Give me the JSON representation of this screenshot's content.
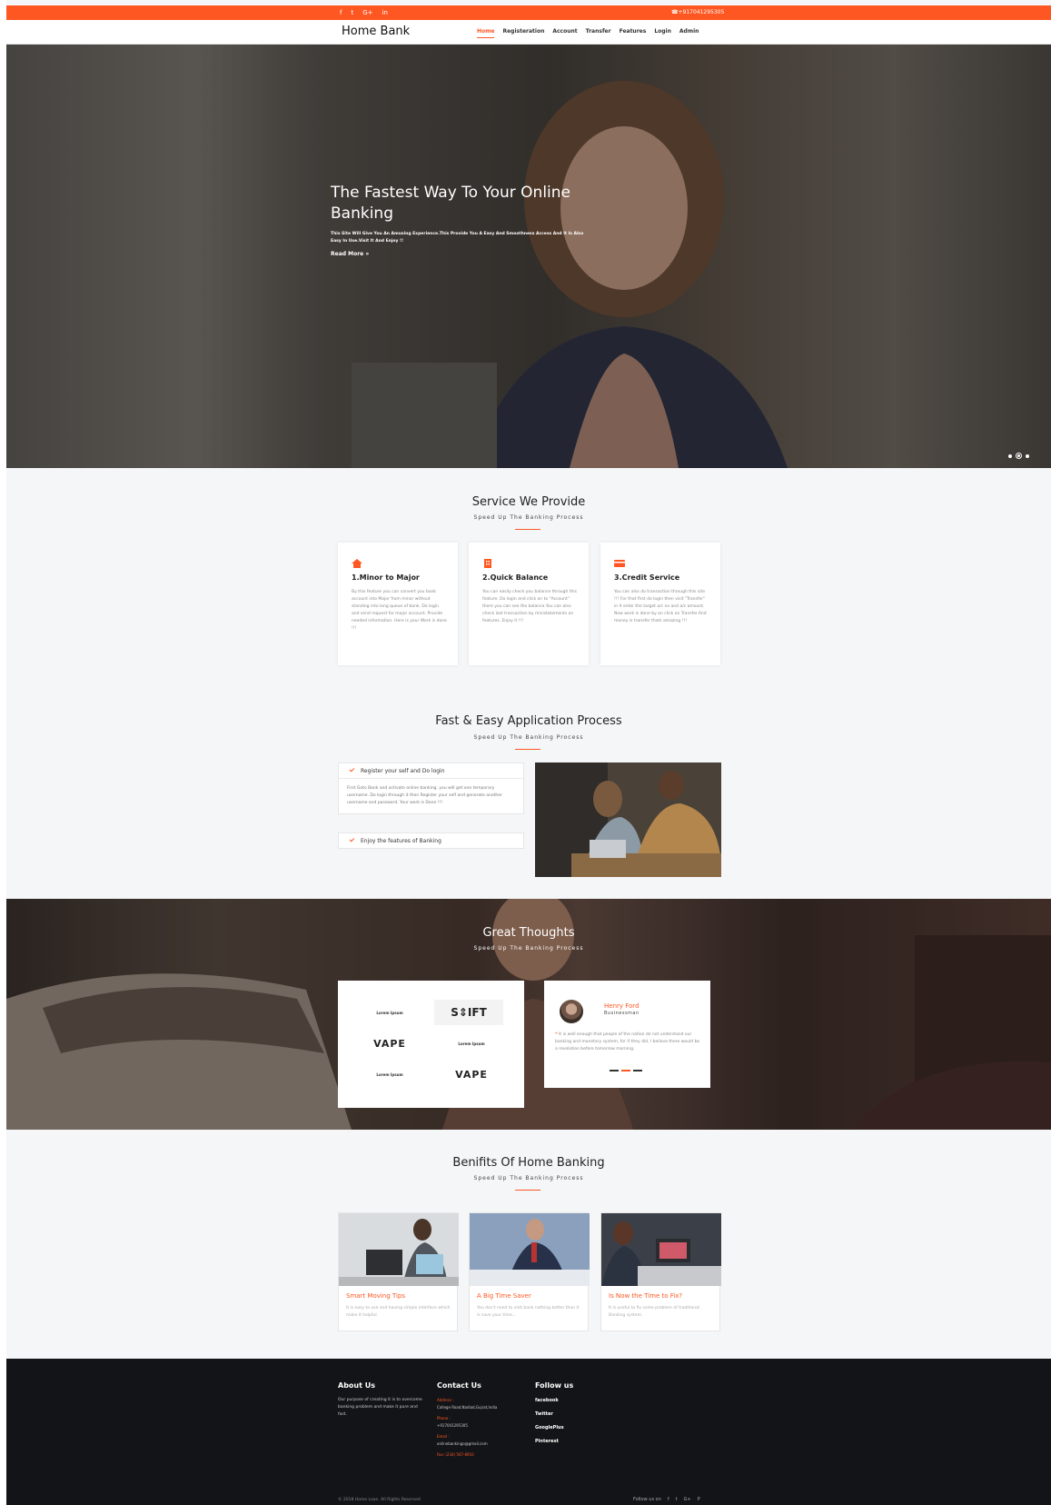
{
  "topbar": {
    "social": [
      "f",
      "t",
      "G+",
      "in"
    ],
    "phone": "☎+917041295305"
  },
  "nav": {
    "brand": "Home Bank",
    "items": [
      "Home",
      "Registeration",
      "Account",
      "Transfer",
      "Features",
      "Login",
      "Admin"
    ]
  },
  "hero": {
    "title": "The Fastest Way To Your Online Banking",
    "text": "This Site Will Give You An Amusing Experience.This Provide You A Easy And Smoothness Access And It Is Also Easy In Use.Visit It And Enjoy !!",
    "read_more": "Read More »"
  },
  "services": {
    "title": "Service We Provide",
    "subtitle": "Speed Up The Banking Process",
    "items": [
      {
        "title": "1.Minor to Major",
        "text": "By this feature you can convert you bank account into Major from minor without standing into long queue of bank. Do login and send request for major account. Provide needed information. Here is your Work is done !!!"
      },
      {
        "title": "2.Quick Balance",
        "text": "You can easily check you balance through this feature. Do login and click on to \"Account\" there you can see the balance.You can also check last transaction by ministatements on features. Enjoy it !!!"
      },
      {
        "title": "3.Credit Service",
        "text": "You can also do transaction through this site !!! For that first do login then visit \"Transfer\" in it enter the target a/c no and a/c amount. Now work is done by an click on Transfer.And money is transfer thats amazing !!!"
      }
    ]
  },
  "application": {
    "title": "Fast & Easy Application Process",
    "subtitle": "Speed Up The Banking Process",
    "step1_title": "Register your self and Do login",
    "step1_text": "First Goto Bank and activate online banking. you will get one temporary username. Do login through it then Register your self and generate another username and password. Your work is Done !!!",
    "step2_title": "Enjoy the features of Banking"
  },
  "thoughts": {
    "title": "Great Thoughts",
    "subtitle": "Speed Up The Banking Process",
    "logos": {
      "lorem_ipsum": "Lorem Ipsum",
      "shift": "S⇕IFT",
      "vape": "VAPE"
    },
    "quote": {
      "name": "Henry Ford",
      "role": "Businessman",
      "mark": "❝",
      "text": "It is well enough that people of the nation do not understand our banking and monetary system, for if they did, I believe there would be a revolution before tomorrow morning."
    }
  },
  "benefits": {
    "title": "Benifits Of Home Banking",
    "subtitle": "Speed Up The Banking Process",
    "items": [
      {
        "title": "Smart Moving Tips",
        "text": "It is easy to use and having simple interface which make it helpful."
      },
      {
        "title": "A Big Time Saver",
        "text": "You don't need to visit bank nothing better than it is save your time..."
      },
      {
        "title": "Is Now the Time to Fix?",
        "text": "It is useful to fix some problem of traditional Banking system."
      }
    ]
  },
  "footer": {
    "about_title": "About Us",
    "about_text": "Our purpose of creating it is to overcome banking problem and make it pure and fast.",
    "contact_title": "Contact Us",
    "address_label": "Address :",
    "address": "College Road,Nadiad,Gujrat,India",
    "phone_label": "Phone :",
    "phone": "+917041295305",
    "email_label": "Email :",
    "email": "onlinebankingo@gmail.com",
    "fax": "Fax: (234) 567-8910",
    "follow_title": "Follow us",
    "follow": [
      "facebook",
      "Twitter",
      "GooglePlus",
      "Pinterest"
    ],
    "copyright": "© 2018 Home Loan. All Rights Reserved",
    "follow_us_label": "Follow us on",
    "follow_icons": [
      "f",
      "t",
      "G+",
      "P"
    ]
  }
}
